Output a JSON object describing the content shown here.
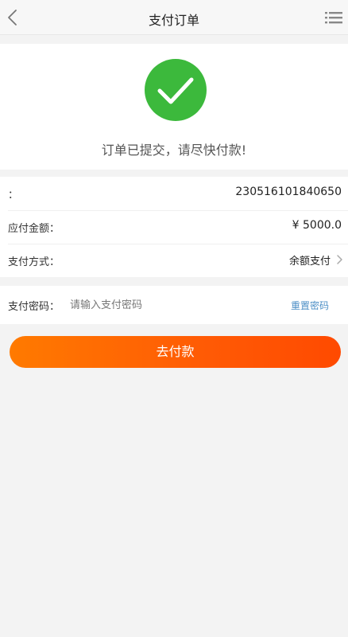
{
  "header": {
    "title": "支付订单"
  },
  "success": {
    "message": "订单已提交，请尽快付款!",
    "color": "#3cb93c"
  },
  "order": {
    "number_label": "：",
    "number_value": "230516101840650",
    "amount_label": "应付金额：",
    "amount_value": "¥ 5000.0",
    "method_label": "支付方式：",
    "method_value": "余额支付"
  },
  "password": {
    "label": "支付密码：",
    "placeholder": "请输入支付密码",
    "reset_label": "重置密码"
  },
  "actions": {
    "pay_label": "去付款",
    "accent_color": "#ff5a05"
  }
}
